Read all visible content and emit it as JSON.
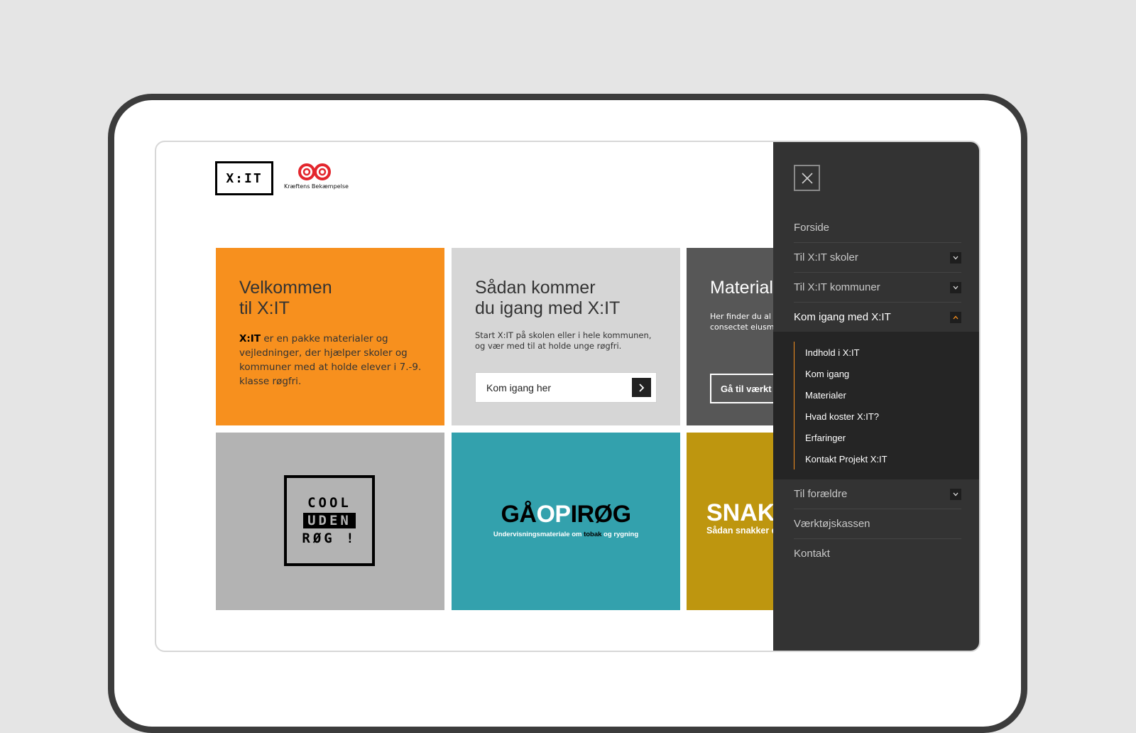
{
  "logos": {
    "xit": "X:IT",
    "kb_name": "Kræftens Bekæmpelse",
    "kb_color": "#e3262d"
  },
  "tiles": {
    "welcome": {
      "title": "Velkommen\ntil X:IT",
      "body_strong": "X:IT",
      "body": " er en pakke materialer og vejledninger, der hjælper skoler og kommuner med at holde elever i 7.-9. klasse røgfri.",
      "color": "#f7901e"
    },
    "getting_started": {
      "title": "Sådan kommer\ndu igang med X:IT",
      "body": "Start X:IT på skolen eller i hele kommunen, og vær med til at holde unge røgfri.",
      "button_label": "Kom igang her",
      "color": "#d6d6d6"
    },
    "materials": {
      "title": "Material",
      "body": "Her finder du al opdelt efter kate amet, consectet eiusmod tempor",
      "button_label": "Gå til værkt",
      "color": "#575757"
    },
    "cool": {
      "line1": "COOL",
      "line2": "UDEN",
      "line3": "RØG !",
      "color": "#b3b3b3"
    },
    "gaa": {
      "part1": "GÅ",
      "part2": "OP",
      "part3": "I",
      "part4": "RØG",
      "sub1": "Undervisningsmateriale om ",
      "sub2": "tobak",
      "sub3": " og ",
      "sub4": "rygning",
      "color": "#33a1ad"
    },
    "snak": {
      "title": "SNAK",
      "sub": "Sådan snakker d",
      "color": "#be960f"
    }
  },
  "drawer": {
    "close_icon": "close-icon",
    "items": [
      {
        "label": "Forside",
        "has_chevron": false
      },
      {
        "label": "Til X:IT skoler",
        "has_chevron": true
      },
      {
        "label": "Til X:IT kommuner",
        "has_chevron": true
      },
      {
        "label": "Kom igang med X:IT",
        "has_chevron": true,
        "expanded": true
      }
    ],
    "submenu": [
      "Indhold i X:IT",
      "Kom igang",
      "Materialer",
      "Hvad koster X:IT?",
      "Erfaringer",
      "Kontakt Projekt X:IT"
    ],
    "items_after": [
      {
        "label": "Til forældre",
        "has_chevron": true
      },
      {
        "label": "Værktøjskassen",
        "has_chevron": false
      },
      {
        "label": "Kontakt",
        "has_chevron": false
      }
    ],
    "accent": "#f7901e"
  }
}
